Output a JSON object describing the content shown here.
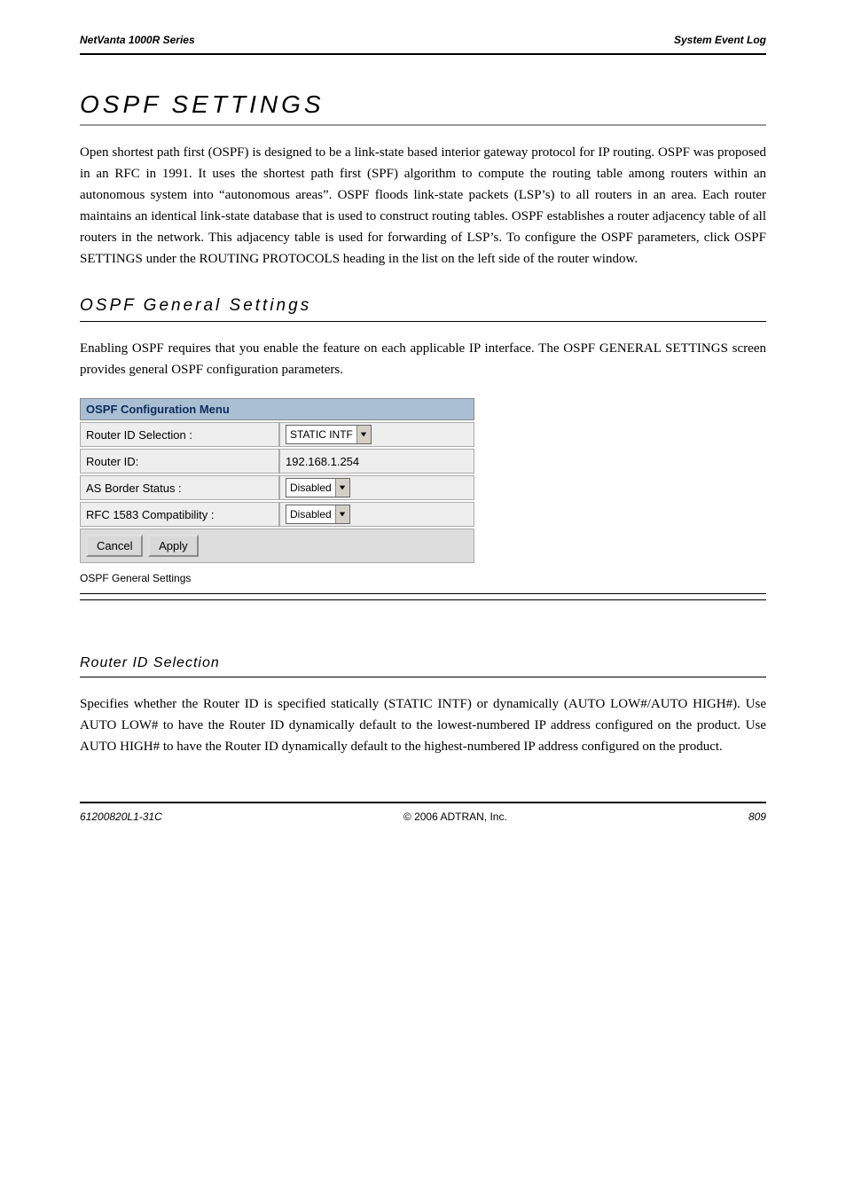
{
  "header": {
    "left": "NetVanta 1000R Series",
    "right": "System Event Log"
  },
  "sections": {
    "ospf": {
      "heading": "OSPF SETTINGS",
      "intro": "Open shortest path first (OSPF) is designed to be a link-state based interior gateway protocol for IP routing. OSPF was proposed in an RFC in 1991. It uses the shortest path first (SPF) algorithm to compute the routing table among routers within an autonomous system into “autonomous areas”. OSPF floods link-state packets (LSP’s) to all routers in an area. Each router maintains an identical link-state database that is used to construct routing tables. OSPF establishes a router adjacency table of all routers in the network. This adjacency table is used for forwarding of LSP’s. To configure the OSPF parameters, click OSPF SETTINGS under the ROUTING PROTOCOLS heading in the list on the left side of the router window.",
      "gen": {
        "heading": "OSPF General Settings",
        "intro": "Enabling OSPF requires that you enable the feature on each applicable IP interface. The OSPF GENERAL SETTINGS screen provides general OSPF configuration parameters.",
        "figcap": "OSPF General Settings"
      }
    },
    "panel": {
      "title": "OSPF Configuration Menu",
      "rows": {
        "router_id_sel": {
          "label": "Router ID Selection :",
          "value": "STATIC INTF"
        },
        "router_id": {
          "label": "Router ID:",
          "value": "192.168.1.254"
        },
        "as_border": {
          "label": "AS Border Status :",
          "value": "Disabled"
        },
        "rfc1583": {
          "label": "RFC 1583 Compatibility :",
          "value": "Disabled"
        }
      },
      "buttons": {
        "cancel": "Cancel",
        "apply": "Apply"
      }
    },
    "param": {
      "name": "Router ID Selection",
      "body": "Specifies whether the Router ID is specified statically (STATIC INTF) or dynamically (AUTO LOW#/AUTO HIGH#). Use AUTO LOW# to have the Router ID dynamically default to the lowest-numbered IP address configured on the product. Use AUTO HIGH# to have the Router ID dynamically default to the highest-numbered IP address configured on the product."
    }
  },
  "footer": {
    "left": "61200820L1-31C",
    "mid": "© 2006 ADTRAN, Inc.",
    "right": "809"
  }
}
